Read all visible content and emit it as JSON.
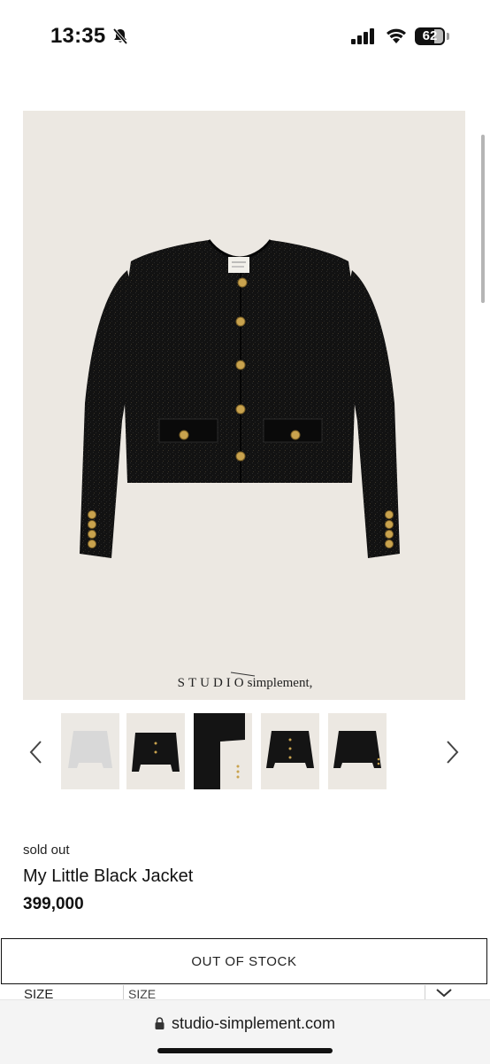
{
  "status_bar": {
    "time": "13:35",
    "battery": "62",
    "battery_level": 0.62,
    "silent": true
  },
  "product_image": {
    "brand": "STUDIO",
    "brand_suffix": "simplement,"
  },
  "gallery": {
    "thumbnail_count": 5,
    "prev_icon": "chevron-left-icon",
    "next_icon": "chevron-right-icon"
  },
  "product": {
    "status": "sold out",
    "name": "My Little Black Jacket",
    "price": "399,000"
  },
  "buy_button": {
    "label": "OUT OF STOCK"
  },
  "options": {
    "size_label": "SIZE",
    "size_value": "SIZE"
  },
  "browser": {
    "url": "studio-simplement.com"
  },
  "colors": {
    "background": "#ffffff",
    "image_background": "#ece8e2",
    "jacket": "#121212",
    "button_gold": "#c9a34e",
    "text": "#111111"
  }
}
